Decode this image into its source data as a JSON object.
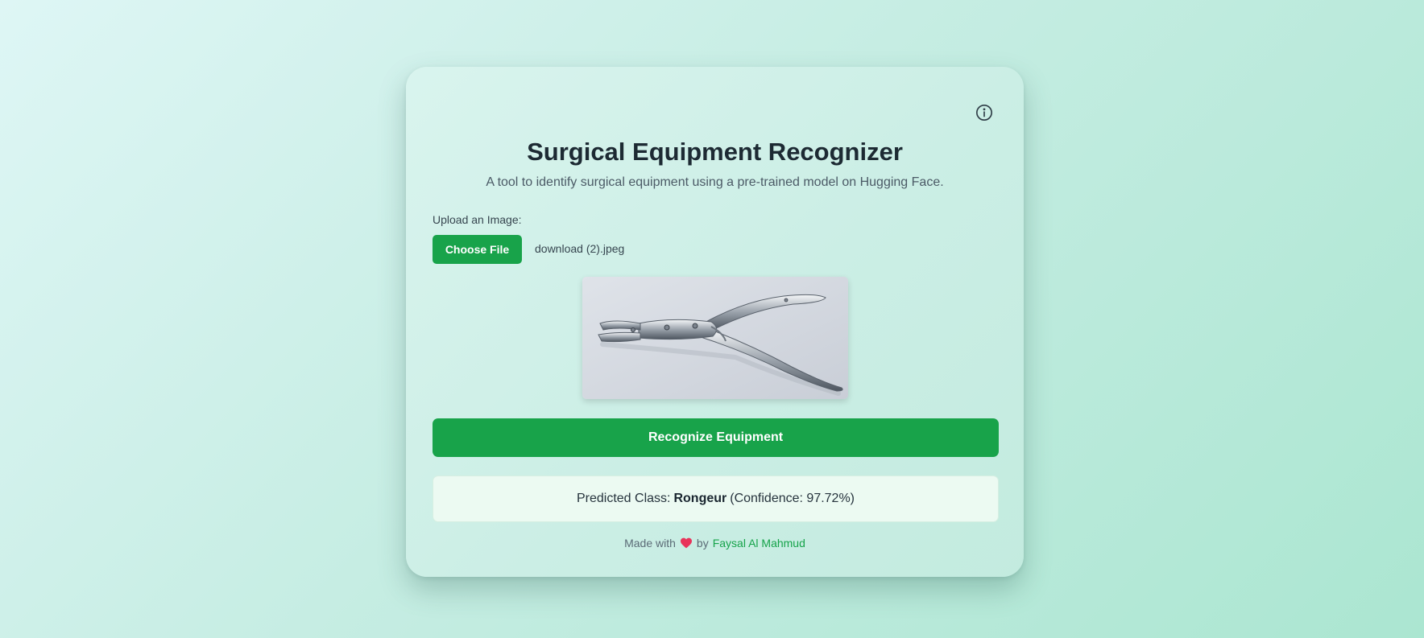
{
  "app": {
    "title": "Surgical Equipment Recognizer",
    "subtitle": "A tool to identify surgical equipment using a pre-trained model on Hugging Face."
  },
  "upload": {
    "label": "Upload an Image:",
    "choose_button": "Choose File",
    "file_name": "download (2).jpeg"
  },
  "actions": {
    "recognize_button": "Recognize Equipment"
  },
  "result": {
    "prefix": "Predicted Class:",
    "class_name": "Rongeur",
    "confidence_text": "(Confidence: 97.72%)"
  },
  "footer": {
    "made_with": "Made with",
    "by": "by",
    "author": "Faysal Al Mahmud"
  },
  "icons": {
    "info": "info-circle-icon",
    "heart": "heart-icon"
  },
  "colors": {
    "accent": "#18a34a",
    "link": "#16a34a",
    "heart": "#e8335a"
  }
}
